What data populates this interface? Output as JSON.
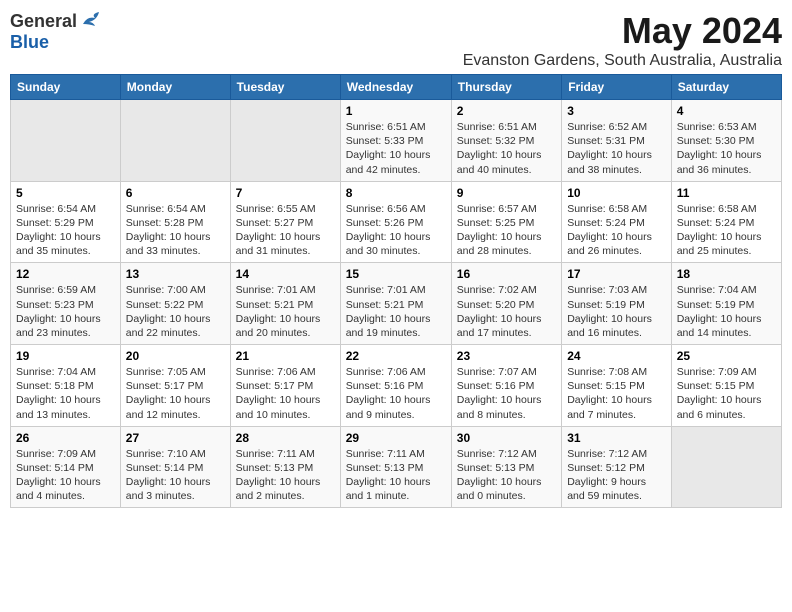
{
  "logo": {
    "general": "General",
    "blue": "Blue"
  },
  "title": "May 2024",
  "subtitle": "Evanston Gardens, South Australia, Australia",
  "days_header": [
    "Sunday",
    "Monday",
    "Tuesday",
    "Wednesday",
    "Thursday",
    "Friday",
    "Saturday"
  ],
  "weeks": [
    [
      {
        "num": "",
        "info": "",
        "empty": true
      },
      {
        "num": "",
        "info": "",
        "empty": true
      },
      {
        "num": "",
        "info": "",
        "empty": true
      },
      {
        "num": "1",
        "info": "Sunrise: 6:51 AM\nSunset: 5:33 PM\nDaylight: 10 hours\nand 42 minutes."
      },
      {
        "num": "2",
        "info": "Sunrise: 6:51 AM\nSunset: 5:32 PM\nDaylight: 10 hours\nand 40 minutes."
      },
      {
        "num": "3",
        "info": "Sunrise: 6:52 AM\nSunset: 5:31 PM\nDaylight: 10 hours\nand 38 minutes."
      },
      {
        "num": "4",
        "info": "Sunrise: 6:53 AM\nSunset: 5:30 PM\nDaylight: 10 hours\nand 36 minutes."
      }
    ],
    [
      {
        "num": "5",
        "info": "Sunrise: 6:54 AM\nSunset: 5:29 PM\nDaylight: 10 hours\nand 35 minutes."
      },
      {
        "num": "6",
        "info": "Sunrise: 6:54 AM\nSunset: 5:28 PM\nDaylight: 10 hours\nand 33 minutes."
      },
      {
        "num": "7",
        "info": "Sunrise: 6:55 AM\nSunset: 5:27 PM\nDaylight: 10 hours\nand 31 minutes."
      },
      {
        "num": "8",
        "info": "Sunrise: 6:56 AM\nSunset: 5:26 PM\nDaylight: 10 hours\nand 30 minutes."
      },
      {
        "num": "9",
        "info": "Sunrise: 6:57 AM\nSunset: 5:25 PM\nDaylight: 10 hours\nand 28 minutes."
      },
      {
        "num": "10",
        "info": "Sunrise: 6:58 AM\nSunset: 5:24 PM\nDaylight: 10 hours\nand 26 minutes."
      },
      {
        "num": "11",
        "info": "Sunrise: 6:58 AM\nSunset: 5:24 PM\nDaylight: 10 hours\nand 25 minutes."
      }
    ],
    [
      {
        "num": "12",
        "info": "Sunrise: 6:59 AM\nSunset: 5:23 PM\nDaylight: 10 hours\nand 23 minutes."
      },
      {
        "num": "13",
        "info": "Sunrise: 7:00 AM\nSunset: 5:22 PM\nDaylight: 10 hours\nand 22 minutes."
      },
      {
        "num": "14",
        "info": "Sunrise: 7:01 AM\nSunset: 5:21 PM\nDaylight: 10 hours\nand 20 minutes."
      },
      {
        "num": "15",
        "info": "Sunrise: 7:01 AM\nSunset: 5:21 PM\nDaylight: 10 hours\nand 19 minutes."
      },
      {
        "num": "16",
        "info": "Sunrise: 7:02 AM\nSunset: 5:20 PM\nDaylight: 10 hours\nand 17 minutes."
      },
      {
        "num": "17",
        "info": "Sunrise: 7:03 AM\nSunset: 5:19 PM\nDaylight: 10 hours\nand 16 minutes."
      },
      {
        "num": "18",
        "info": "Sunrise: 7:04 AM\nSunset: 5:19 PM\nDaylight: 10 hours\nand 14 minutes."
      }
    ],
    [
      {
        "num": "19",
        "info": "Sunrise: 7:04 AM\nSunset: 5:18 PM\nDaylight: 10 hours\nand 13 minutes."
      },
      {
        "num": "20",
        "info": "Sunrise: 7:05 AM\nSunset: 5:17 PM\nDaylight: 10 hours\nand 12 minutes."
      },
      {
        "num": "21",
        "info": "Sunrise: 7:06 AM\nSunset: 5:17 PM\nDaylight: 10 hours\nand 10 minutes."
      },
      {
        "num": "22",
        "info": "Sunrise: 7:06 AM\nSunset: 5:16 PM\nDaylight: 10 hours\nand 9 minutes."
      },
      {
        "num": "23",
        "info": "Sunrise: 7:07 AM\nSunset: 5:16 PM\nDaylight: 10 hours\nand 8 minutes."
      },
      {
        "num": "24",
        "info": "Sunrise: 7:08 AM\nSunset: 5:15 PM\nDaylight: 10 hours\nand 7 minutes."
      },
      {
        "num": "25",
        "info": "Sunrise: 7:09 AM\nSunset: 5:15 PM\nDaylight: 10 hours\nand 6 minutes."
      }
    ],
    [
      {
        "num": "26",
        "info": "Sunrise: 7:09 AM\nSunset: 5:14 PM\nDaylight: 10 hours\nand 4 minutes."
      },
      {
        "num": "27",
        "info": "Sunrise: 7:10 AM\nSunset: 5:14 PM\nDaylight: 10 hours\nand 3 minutes."
      },
      {
        "num": "28",
        "info": "Sunrise: 7:11 AM\nSunset: 5:13 PM\nDaylight: 10 hours\nand 2 minutes."
      },
      {
        "num": "29",
        "info": "Sunrise: 7:11 AM\nSunset: 5:13 PM\nDaylight: 10 hours\nand 1 minute."
      },
      {
        "num": "30",
        "info": "Sunrise: 7:12 AM\nSunset: 5:13 PM\nDaylight: 10 hours\nand 0 minutes."
      },
      {
        "num": "31",
        "info": "Sunrise: 7:12 AM\nSunset: 5:12 PM\nDaylight: 9 hours\nand 59 minutes."
      },
      {
        "num": "",
        "info": "",
        "empty": true
      }
    ]
  ]
}
